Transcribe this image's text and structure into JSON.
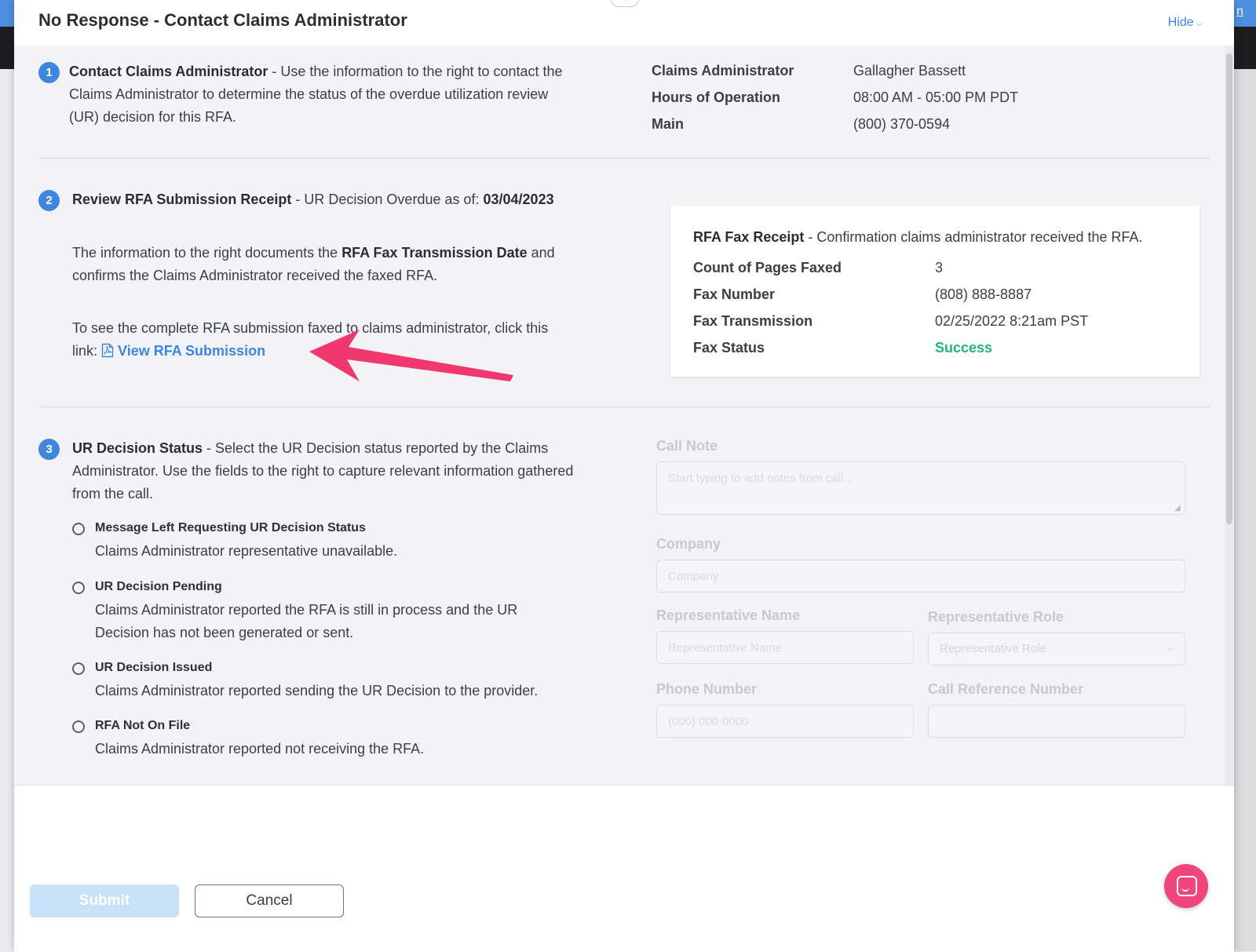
{
  "background": {
    "corner_link": "n"
  },
  "modal": {
    "title": "No Response - Contact Claims Administrator",
    "hide_label": "Hide",
    "collapse_glyph": "▾"
  },
  "step1": {
    "number": "1",
    "title": "Contact Claims Administrator",
    "text": " - Use the information to the right to contact the Claims Administrator to determine the status of the overdue utilization review (UR) decision for this RFA.",
    "info": [
      {
        "label": "Claims Administrator",
        "value": "Gallagher Bassett"
      },
      {
        "label": "Hours of Operation",
        "value": "08:00 AM - 05:00 PM PDT"
      },
      {
        "label": "Main",
        "value": "(800) 370-0594"
      }
    ]
  },
  "step2": {
    "number": "2",
    "title": "Review RFA Submission Receipt",
    "subtitle": " - UR Decision Overdue as of: ",
    "overdue_date": "03/04/2023",
    "para1_a": "The information to the right documents the ",
    "para1_bold": "RFA Fax Transmission Date",
    "para1_b": " and confirms the Claims Administrator received the faxed RFA.",
    "para2": "To see the complete RFA submission faxed to claims administrator, click this link: ",
    "link_label": "View RFA Submission",
    "receipt": {
      "title": "RFA Fax Receipt",
      "subtitle": " - Confirmation claims administrator received the RFA.",
      "rows": [
        {
          "label": "Count of Pages Faxed",
          "value": "3"
        },
        {
          "label": "Fax Number",
          "value": "(808) 888-8887"
        },
        {
          "label": "Fax Transmission",
          "value": "02/25/2022 8:21am PST"
        },
        {
          "label": "Fax Status",
          "value": "Success"
        }
      ],
      "status_color": "#20b57a"
    }
  },
  "step3": {
    "number": "3",
    "title": "UR Decision Status",
    "text": " - Select the UR Decision status reported by the Claims Administrator. Use the fields to the right to capture relevant information gathered from the call.",
    "options": [
      {
        "title": "Message Left Requesting UR Decision Status",
        "desc": "Claims Administrator representative unavailable."
      },
      {
        "title": "UR Decision Pending",
        "desc": "Claims Administrator reported the RFA is still in process and the UR Decision has not been generated or sent."
      },
      {
        "title": "UR Decision Issued",
        "desc": "Claims Administrator reported sending the UR Decision to the provider."
      },
      {
        "title": "RFA Not On File",
        "desc": "Claims Administrator reported not receiving the RFA."
      }
    ],
    "form": {
      "call_note_label": "Call Note",
      "call_note_placeholder": "Start typing to add notes from call...",
      "company_label": "Company",
      "company_placeholder": "Company",
      "rep_name_label": "Representative Name",
      "rep_name_placeholder": "Representative Name",
      "rep_role_label": "Representative Role",
      "rep_role_placeholder": "Representative Role",
      "phone_label": "Phone Number",
      "phone_placeholder": "(000) 000-0000",
      "call_ref_label": "Call Reference Number",
      "call_ref_placeholder": ""
    }
  },
  "footer": {
    "submit_label": "Submit",
    "cancel_label": "Cancel"
  },
  "colors": {
    "accent": "#3f86dc",
    "annotation_arrow": "#f0386f",
    "chat_bubble": "#f0467d"
  },
  "icons": {
    "pdf": "pdf-file-icon",
    "chevron": "chevron-down-icon",
    "chat": "chat-icon"
  }
}
